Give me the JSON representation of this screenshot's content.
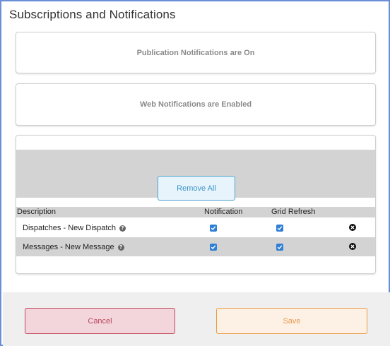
{
  "dialog": {
    "title": "Subscriptions and Notifications"
  },
  "status": {
    "publication": "Publication Notifications are On",
    "web": "Web Notifications are Enabled"
  },
  "subscriptions": {
    "remove_all_label": "Remove All",
    "columns": {
      "description": "Description",
      "notification": "Notification",
      "grid_refresh": "Grid Refresh"
    },
    "rows": [
      {
        "description": "Dispatches - New Dispatch",
        "notification": true,
        "grid_refresh": true
      },
      {
        "description": "Messages - New Message",
        "notification": true,
        "grid_refresh": true
      }
    ]
  },
  "footer": {
    "cancel_label": "Cancel",
    "save_label": "Save"
  },
  "colors": {
    "checkbox": "#2f7fd6",
    "cancel_border": "#c0485b",
    "save_border": "#ec9a47",
    "remove_all_border": "#49a3d3"
  }
}
